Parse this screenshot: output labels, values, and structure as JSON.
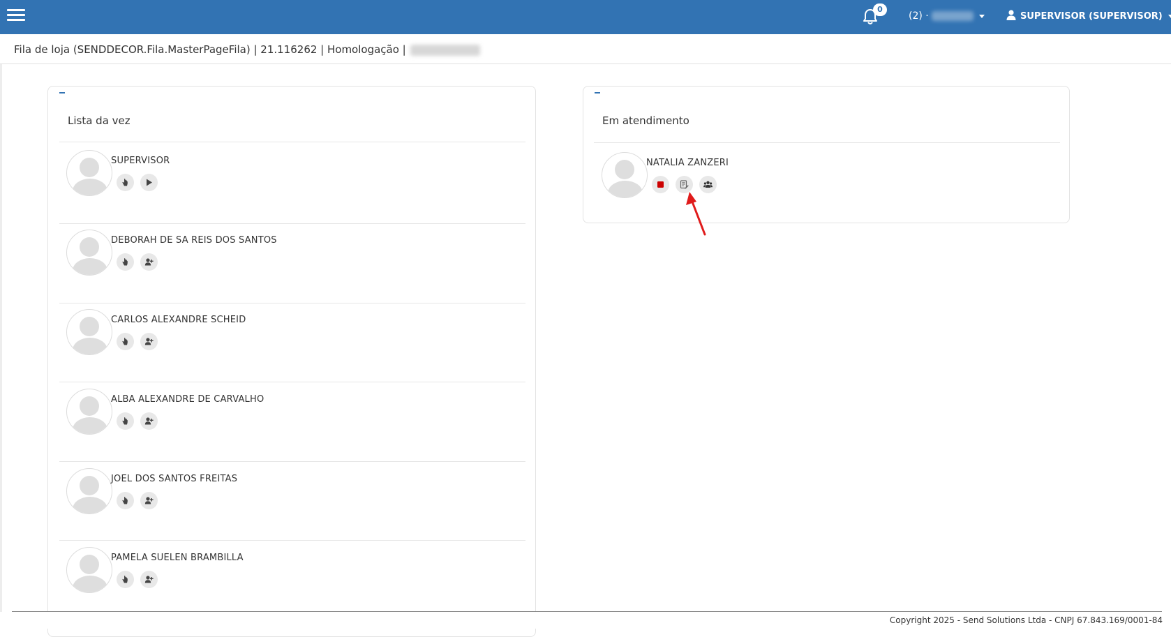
{
  "header": {
    "notifications_count": "0",
    "store_label": "(2) ·",
    "user_label": "SUPERVISOR (SUPERVISOR)"
  },
  "breadcrumb": {
    "text": "Fila de loja (SENDDECOR.Fila.MasterPageFila) | 21.116262 | Homologação |"
  },
  "queue_panel": {
    "title": "Lista da vez",
    "entries": [
      {
        "name": "SUPERVISOR",
        "actions": [
          "hand-icon",
          "play-icon"
        ]
      },
      {
        "name": "DEBORAH DE SA REIS DOS SANTOS",
        "actions": [
          "hand-icon",
          "user-plus-icon"
        ]
      },
      {
        "name": "CARLOS ALEXANDRE SCHEID",
        "actions": [
          "hand-icon",
          "user-plus-icon"
        ]
      },
      {
        "name": "ALBA ALEXANDRE DE CARVALHO",
        "actions": [
          "hand-icon",
          "user-plus-icon"
        ]
      },
      {
        "name": "JOEL DOS SANTOS FREITAS",
        "actions": [
          "hand-icon",
          "user-plus-icon"
        ]
      },
      {
        "name": "PAMELA SUELEN BRAMBILLA",
        "actions": [
          "hand-icon",
          "user-plus-icon"
        ]
      }
    ]
  },
  "serving_panel": {
    "title": "Em atendimento",
    "entries": [
      {
        "name": "NATALIA ZANZERI",
        "actions": [
          "stop-icon",
          "edit-note-icon",
          "group-icon"
        ]
      }
    ]
  },
  "colors": {
    "header_bg": "#3273b3",
    "stop_red": "#cc0000",
    "annotation_arrow": "#e01b1b"
  },
  "footer": {
    "text": "Copyright 2025 - Send Solutions Ltda - CNPJ 67.843.169/0001-84"
  }
}
